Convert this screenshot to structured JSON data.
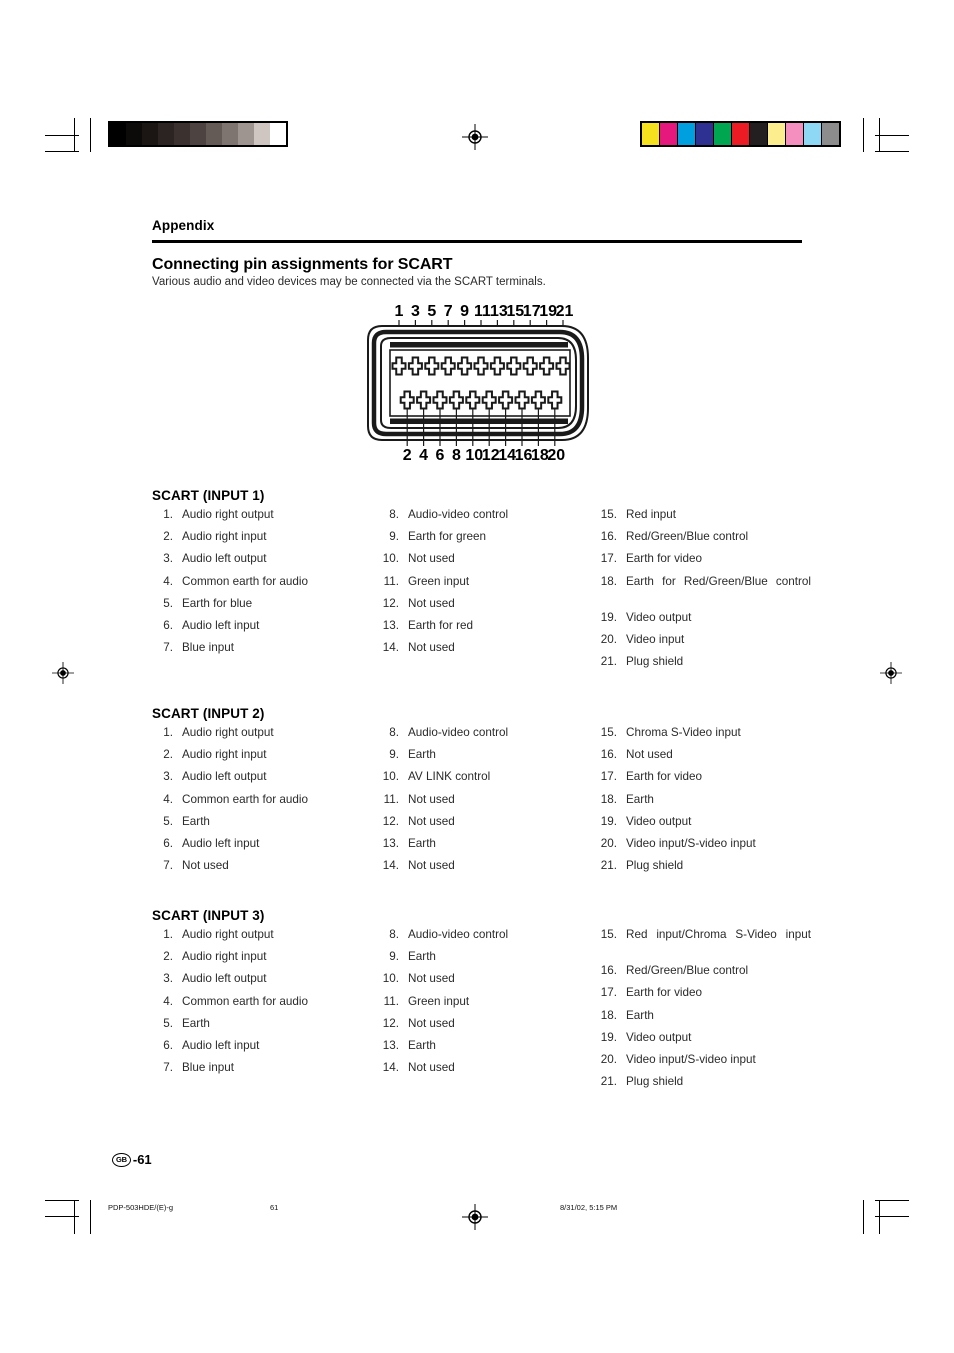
{
  "page": {
    "appendix_label": "Appendix",
    "section_title": "Connecting pin assignments for SCART",
    "section_subtitle": "Various audio and video devices may be connected via the SCART terminals.",
    "page_number_badge": "GB",
    "page_number": "-61"
  },
  "diagram": {
    "name": "scart-connector-21-pin",
    "top_pin_numbers": [
      "1",
      "3",
      "5",
      "7",
      "9",
      "11",
      "13",
      "15",
      "17",
      "19",
      "21"
    ],
    "bottom_pin_numbers": [
      "2",
      "4",
      "6",
      "8",
      "10",
      "12",
      "14",
      "16",
      "18",
      "20"
    ]
  },
  "calibration": {
    "grayscale_bar": [
      "#000000",
      "#0d0a0a",
      "#1b1614",
      "#2b2422",
      "#3b3230",
      "#4d4340",
      "#645a56",
      "#7e7470",
      "#9e9490",
      "#cfc6c2",
      "#ffffff"
    ],
    "color_bar": [
      "#f5e11e",
      "#e6187d",
      "#00a0e0",
      "#2e3192",
      "#00a650",
      "#ed1c24",
      "#231f20",
      "#fcee8f",
      "#f48fc0",
      "#8fd8f5",
      "#8c8c8c"
    ]
  },
  "sections": [
    {
      "title": "SCART (INPUT 1)",
      "columns": [
        [
          {
            "num": "1.",
            "label": "Audio right output"
          },
          {
            "num": "2.",
            "label": "Audio right input"
          },
          {
            "num": "3.",
            "label": "Audio left output"
          },
          {
            "num": "4.",
            "label": "Common earth for audio"
          },
          {
            "num": "5.",
            "label": "Earth for blue"
          },
          {
            "num": "6.",
            "label": "Audio left input"
          },
          {
            "num": "7.",
            "label": "Blue input"
          }
        ],
        [
          {
            "num": "8.",
            "label": "Audio-video control"
          },
          {
            "num": "9.",
            "label": "Earth for green"
          },
          {
            "num": "10.",
            "label": "Not used"
          },
          {
            "num": "11.",
            "label": "Green input"
          },
          {
            "num": "12.",
            "label": "Not used"
          },
          {
            "num": "13.",
            "label": "Earth for red"
          },
          {
            "num": "14.",
            "label": "Not used"
          }
        ],
        [
          {
            "num": "15.",
            "label": "Red input"
          },
          {
            "num": "16.",
            "label": "Red/Green/Blue control"
          },
          {
            "num": "17.",
            "label": "Earth for video"
          },
          {
            "num": "18.",
            "label": "Earth for Red/Green/Blue control",
            "justify": true
          },
          {
            "num": "19.",
            "label": "Video output"
          },
          {
            "num": "20.",
            "label": "Video input"
          },
          {
            "num": "21.",
            "label": "Plug shield"
          }
        ]
      ]
    },
    {
      "title": "SCART (INPUT 2)",
      "columns": [
        [
          {
            "num": "1.",
            "label": "Audio right output"
          },
          {
            "num": "2.",
            "label": "Audio right input"
          },
          {
            "num": "3.",
            "label": "Audio left output"
          },
          {
            "num": "4.",
            "label": "Common earth for audio"
          },
          {
            "num": "5.",
            "label": "Earth"
          },
          {
            "num": "6.",
            "label": "Audio left input"
          },
          {
            "num": "7.",
            "label": "Not used"
          }
        ],
        [
          {
            "num": "8.",
            "label": "Audio-video control"
          },
          {
            "num": "9.",
            "label": "Earth"
          },
          {
            "num": "10.",
            "label": "AV LINK control"
          },
          {
            "num": "11.",
            "label": "Not used"
          },
          {
            "num": "12.",
            "label": "Not used"
          },
          {
            "num": "13.",
            "label": "Earth"
          },
          {
            "num": "14.",
            "label": "Not used"
          }
        ],
        [
          {
            "num": "15.",
            "label": "Chroma S-Video input"
          },
          {
            "num": "16.",
            "label": "Not used"
          },
          {
            "num": "17.",
            "label": "Earth for video"
          },
          {
            "num": "18.",
            "label": "Earth"
          },
          {
            "num": "19.",
            "label": "Video output"
          },
          {
            "num": "20.",
            "label": "Video input/S-video input"
          },
          {
            "num": "21.",
            "label": "Plug shield"
          }
        ]
      ]
    },
    {
      "title": "SCART (INPUT 3)",
      "columns": [
        [
          {
            "num": "1.",
            "label": "Audio right output"
          },
          {
            "num": "2.",
            "label": "Audio right input"
          },
          {
            "num": "3.",
            "label": "Audio left output"
          },
          {
            "num": "4.",
            "label": "Common earth for audio"
          },
          {
            "num": "5.",
            "label": "Earth"
          },
          {
            "num": "6.",
            "label": "Audio left input"
          },
          {
            "num": "7.",
            "label": "Blue input"
          }
        ],
        [
          {
            "num": "8.",
            "label": "Audio-video control"
          },
          {
            "num": "9.",
            "label": "Earth"
          },
          {
            "num": "10.",
            "label": "Not used"
          },
          {
            "num": "11.",
            "label": "Green input"
          },
          {
            "num": "12.",
            "label": "Not used"
          },
          {
            "num": "13.",
            "label": "Earth"
          },
          {
            "num": "14.",
            "label": "Not used"
          }
        ],
        [
          {
            "num": "15.",
            "label": "Red input/Chroma S-Video input",
            "justify": true
          },
          {
            "num": "16.",
            "label": "Red/Green/Blue control"
          },
          {
            "num": "17.",
            "label": "Earth for video"
          },
          {
            "num": "18.",
            "label": "Earth"
          },
          {
            "num": "19.",
            "label": "Video output"
          },
          {
            "num": "20.",
            "label": "Video input/S-video input"
          },
          {
            "num": "21.",
            "label": "Plug shield"
          }
        ]
      ]
    }
  ],
  "print_footer": {
    "filename": "PDP-503HDE/(E)-g",
    "page": "61",
    "timestamp": "8/31/02, 5:15 PM"
  }
}
